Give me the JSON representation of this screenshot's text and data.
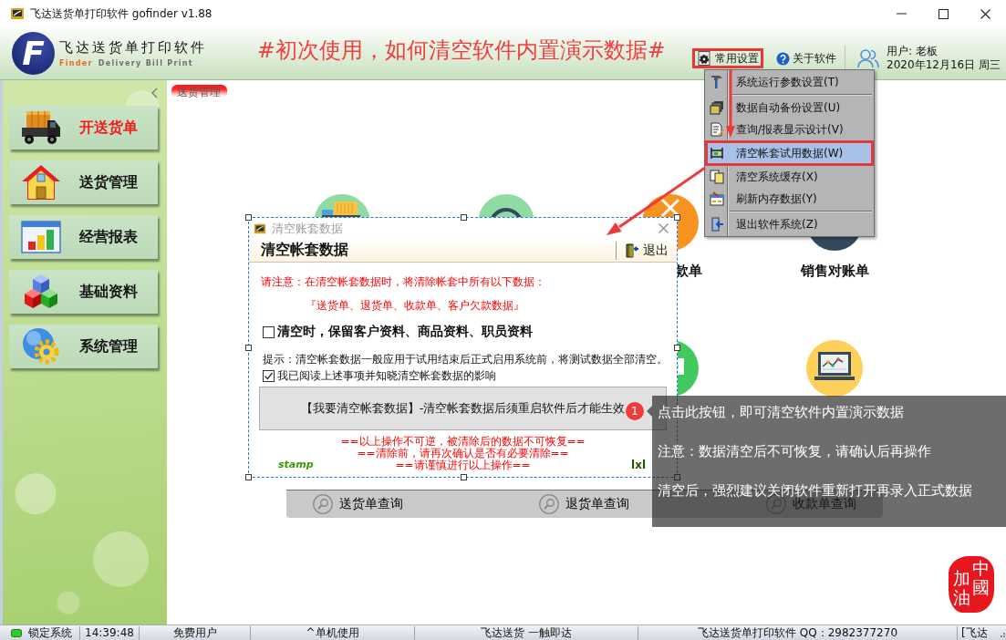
{
  "window": {
    "title": "飞达送货单打印软件 gofinder v1.88"
  },
  "header": {
    "logo_mark": "F",
    "app_name": "飞达送货单打印软件",
    "tagline_brand": "Finder",
    "tagline": "Delivery Bill Print",
    "headline": "#初次使用，如何清空软件内置演示数据#",
    "settings_button": {
      "label": "常用设置",
      "marked": true
    },
    "about_button": {
      "label": "关于软件"
    },
    "user": "用户: 老板",
    "date": "2020年12月16日 周三"
  },
  "settings_menu": {
    "items": [
      {
        "kind": "item",
        "label": "系统运行参数设置(T)",
        "selected": false,
        "marked": false
      },
      {
        "kind": "separator"
      },
      {
        "kind": "item",
        "label": "数据自动备份设置(U)",
        "selected": false,
        "marked": false
      },
      {
        "kind": "item",
        "label": "查询/报表显示设计(V)",
        "selected": false,
        "marked": false
      },
      {
        "kind": "item",
        "label": "清空帐套试用数据(W)",
        "selected": true,
        "marked": true
      },
      {
        "kind": "item",
        "label": "清空系统缓存(X)",
        "selected": false,
        "marked": false
      },
      {
        "kind": "item",
        "label": "刷新内存数据(Y)",
        "selected": false,
        "marked": false
      },
      {
        "kind": "separator"
      },
      {
        "kind": "item",
        "label": "退出软件系统(Z)",
        "selected": false,
        "marked": false
      }
    ]
  },
  "sidebar": {
    "items": [
      {
        "label": "开送货单",
        "selected": true
      },
      {
        "label": "送货管理",
        "selected": false
      },
      {
        "label": "经营报表",
        "selected": false
      },
      {
        "label": "基础资料",
        "selected": false
      },
      {
        "label": "系统管理",
        "selected": false
      }
    ]
  },
  "tabs": [
    {
      "label": "送货管理",
      "selected": true
    }
  ],
  "launcher": {
    "row_1": [
      {
        "kind": "truck"
      },
      {
        "kind": "cycle"
      },
      {
        "kind": "cross",
        "label": "款单"
      },
      {
        "kind": "printer",
        "label": "销售对账单"
      }
    ],
    "row_2": [
      {
        "kind": "chat"
      },
      {
        "kind": "laptop"
      }
    ]
  },
  "query_bar": {
    "buttons": [
      "送货单查询",
      "退货单查询",
      "收款单查询"
    ]
  },
  "dialog": {
    "window_title": "清空账套数据",
    "heading": "清空帐套数据",
    "exit_button": "退出",
    "warning": "请注意：在清空帐套数据时，将清除帐套中所有以下数据：",
    "affected_data": "『送货单、退货单、收款单、客户欠款数据』",
    "keep_option": {
      "label": "清空时，保留客户资料、商品资料、职员资料",
      "checked": false
    },
    "hint": "提示：清空帐套数据一般应用于试用结束后正式启用系统前，将测试数据全部清空。",
    "confirm_option": {
      "label": "我已阅读上述事项并知晓清空帐套数据的影响",
      "checked": true
    },
    "action_button": "【我要清空帐套数据】-清空帐套数据后须重启软件后才能生效",
    "cautions": [
      "==以上操作不可逆，被清除后的数据不可恢复==",
      "==清除前，请再次确认是否有必要清除==",
      "==请谨慎进行以上操作=="
    ],
    "stamp_label": "stamp",
    "signature": "lxl"
  },
  "callout": {
    "badge": "1",
    "lines": [
      "点击此按钮，即可清空软件内置演示数据",
      "注意：数据清空后不可恢复，请确认后再操作",
      "清空后，强烈建议关闭软件重新打开再录入正式数据"
    ]
  },
  "seal": {
    "columns": [
      "中國",
      "加油"
    ]
  },
  "status_bar": {
    "lock": "锁定系统",
    "time": "14:39:48",
    "cells": [
      "免费用户",
      "^单机使用",
      "飞达送货 一触即达",
      "飞达送货单打印软件 QQ：2982377270",
      "[飞达"
    ]
  }
}
